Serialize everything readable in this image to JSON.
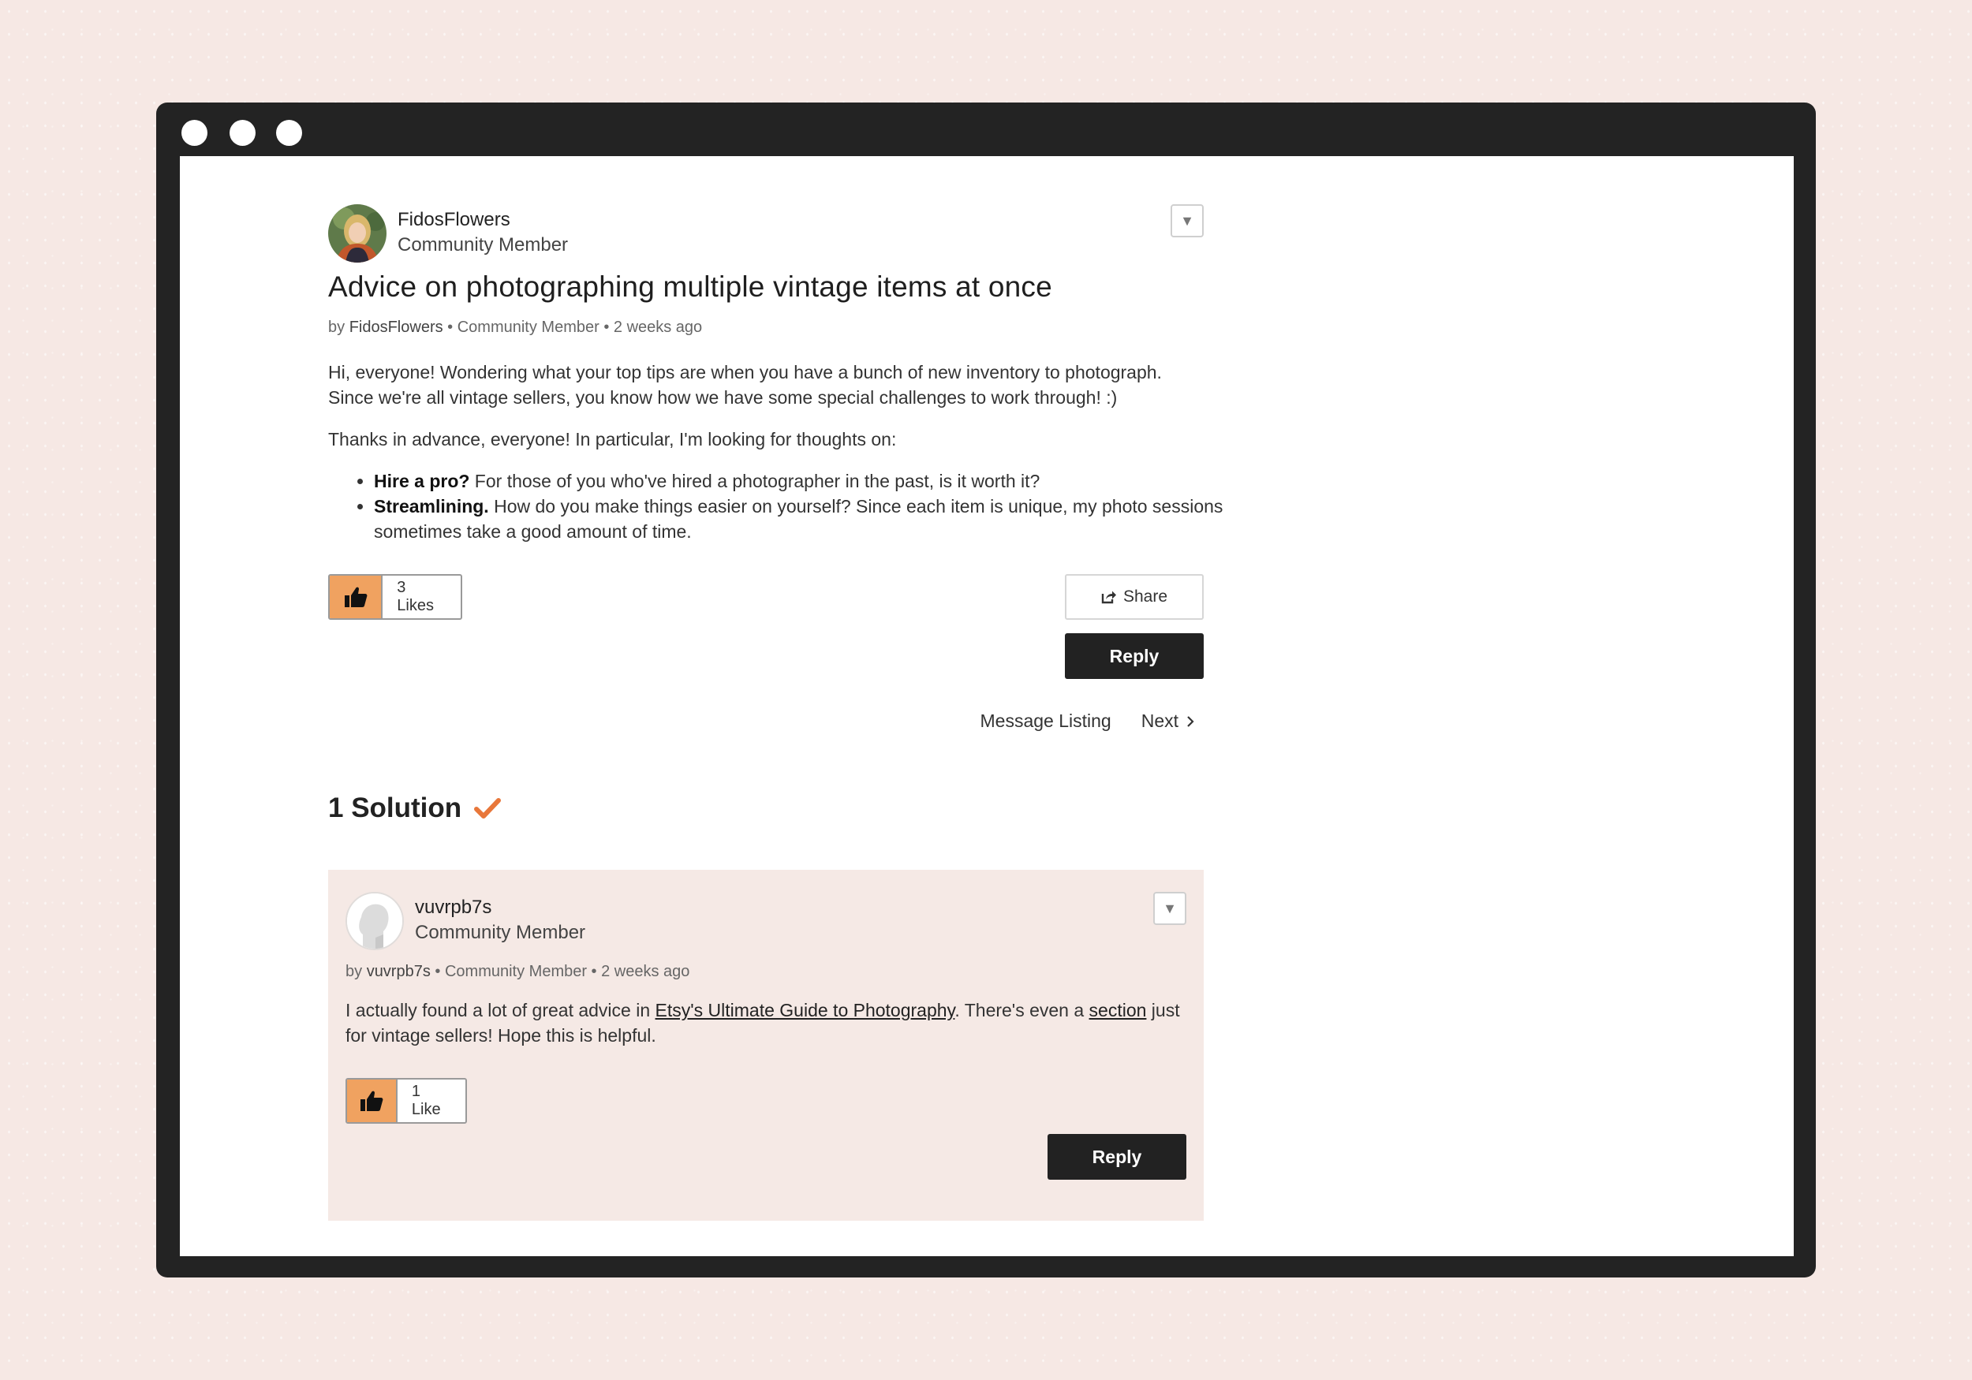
{
  "post": {
    "author_name": "FidosFlowers",
    "author_role": "Community Member",
    "menu_glyph": "▼",
    "title": "Advice on photographing multiple vintage items at once",
    "byline_prefix": "by",
    "byline_author": "FidosFlowers",
    "byline_role": "• Community Member • 2 weeks ago",
    "paragraph1_line1": "Hi, everyone! Wondering what your top tips are when you have a bunch of new inventory to photograph.",
    "paragraph1_line2": "Since we're all vintage sellers, you know how we have some special challenges to work through! :)",
    "paragraph2": "Thanks in advance, everyone! In particular, I'm looking for thoughts on:",
    "bullets": [
      {
        "bold": "Hire a pro?",
        "text": " For those of you who've hired a photographer in the past, is it worth it?"
      },
      {
        "bold": "Streamlining.",
        "text": " How do you make things easier on yourself? Since each item is unique, my photo sessions sometimes take a good amount of time."
      }
    ],
    "likes_label": "3 Likes",
    "share_label": "Share",
    "reply_label": "Reply"
  },
  "nav": {
    "message_listing": "Message Listing",
    "next": "Next"
  },
  "solutions": {
    "heading": "1 Solution",
    "accent_color": "#e8773a"
  },
  "solution": {
    "author_name": "vuvrpb7s",
    "author_role": "Community Member",
    "menu_glyph": "▼",
    "byline_prefix": "by",
    "byline_author": "vuvrpb7s",
    "byline_role": "• Community Member • 2 weeks ago",
    "body_before_link": "I actually found a lot of great advice in ",
    "link1_text": "Etsy's Ultimate Guide to Photography",
    "body_middle": ". There's even a ",
    "link2_text": "section",
    "body_after": " just for vintage sellers! Hope this is helpful.",
    "likes_label": "1 Like",
    "reply_label": "Reply"
  },
  "colors": {
    "frame": "#232323",
    "like_orange": "#f0a260",
    "solution_bg": "#f5e9e5",
    "page_bg": "#f6e8e4"
  }
}
